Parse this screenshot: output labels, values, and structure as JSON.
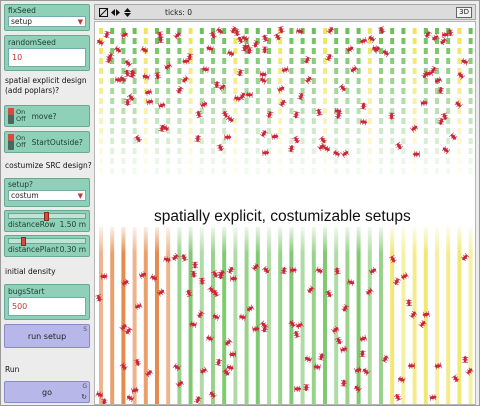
{
  "controls": {
    "fixSeed": {
      "label": "fixSeed",
      "value": "setup"
    },
    "randomSeed": {
      "label": "randomSeed",
      "value": "10"
    },
    "note_spatial": "spatial explicit design (add poplars)?",
    "move": {
      "label": "move?",
      "on": "On",
      "off": "Off",
      "state": "On"
    },
    "startOutside": {
      "label": "StartOutside?",
      "on": "On",
      "off": "Off",
      "state": "On"
    },
    "note_src": "costumize SRC design?",
    "setup": {
      "label": "setup?",
      "value": "costum"
    },
    "distanceRow": {
      "label": "distanceRow",
      "value": "1.50 m",
      "level": 0.45
    },
    "distancePlant": {
      "label": "distancePlant",
      "value": "0.30 m",
      "level": 0.15
    },
    "note_density": "initial density",
    "bugsStart": {
      "label": "bugsStart",
      "value": "500"
    },
    "run_setup": {
      "label": "run setup",
      "key": "S"
    },
    "note_run": "Run",
    "go": {
      "label": "go",
      "key": "G",
      "loop": "↻"
    }
  },
  "toolbar": {
    "ticks": "ticks: 0",
    "view3d": "3D"
  },
  "world": {
    "caption": "spatially explicit, costumizable setups",
    "colors": {
      "green": "#6cbf5a",
      "yellow": "#efe45a",
      "orange": "#e0772f",
      "bug": "#c8283a"
    }
  }
}
